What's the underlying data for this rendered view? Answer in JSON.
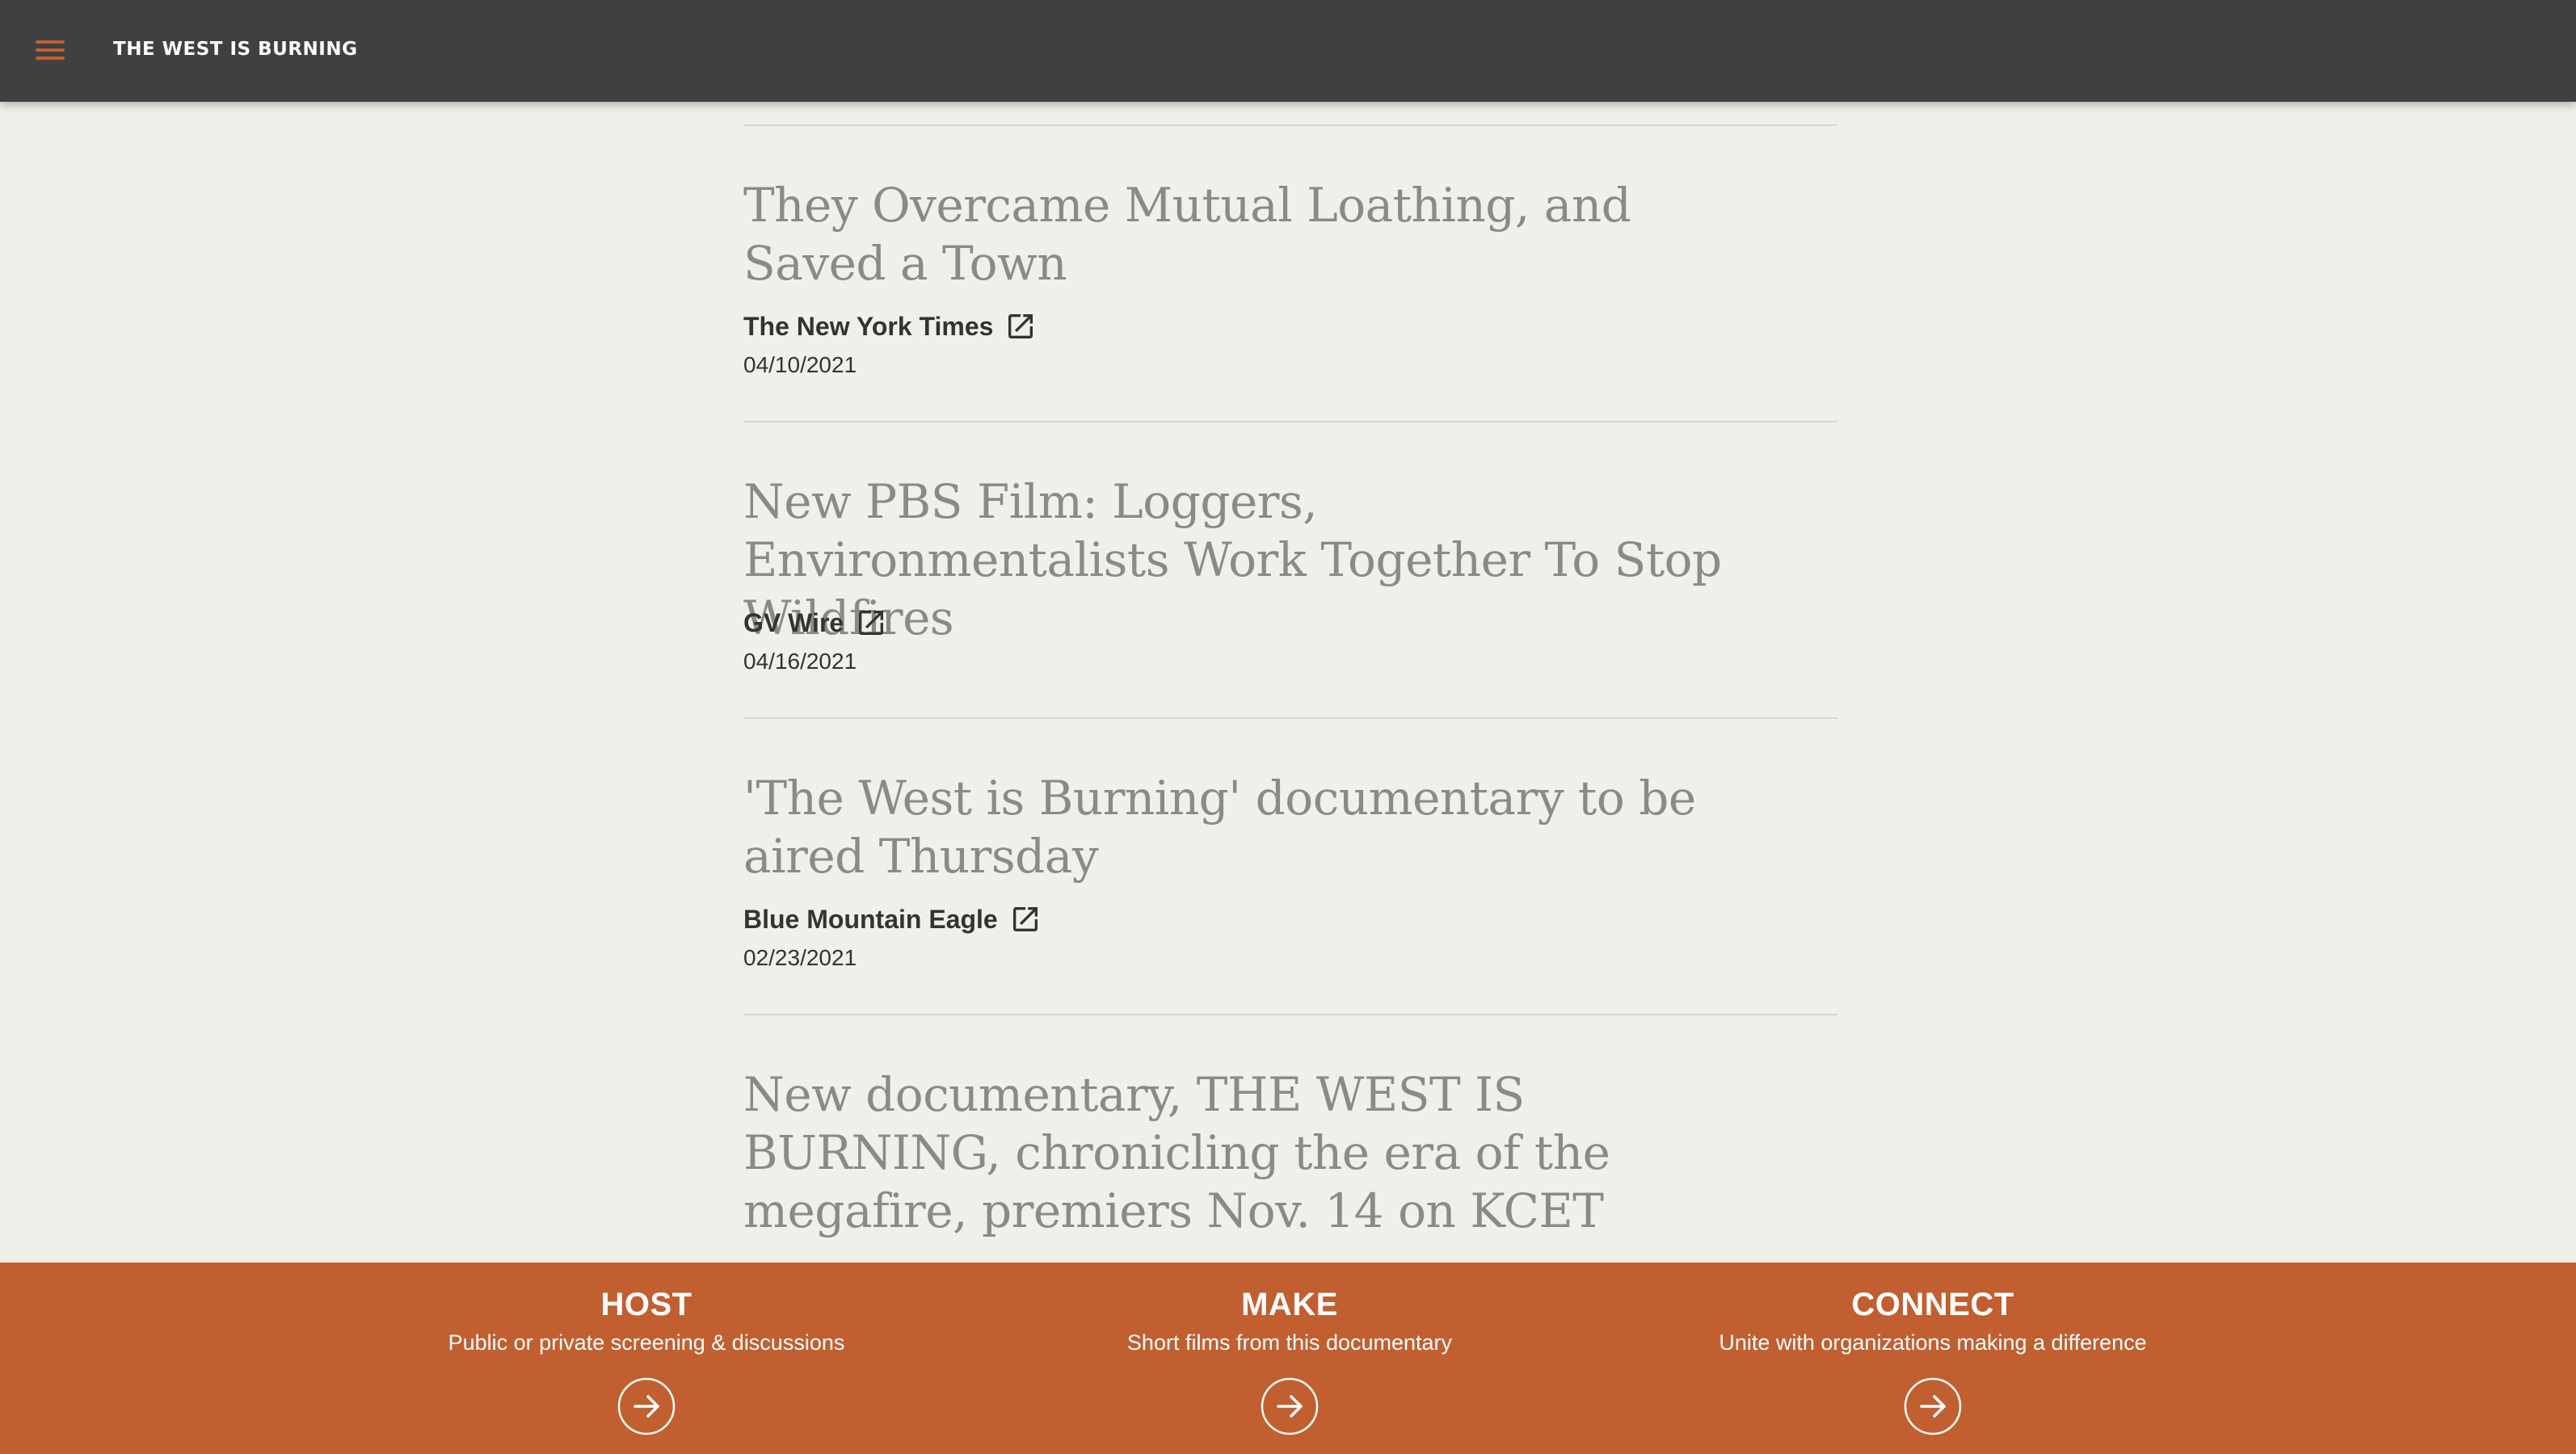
{
  "header": {
    "brand": "THE WEST IS BURNING",
    "menu_icon": "hamburger-menu-icon",
    "accent_color": "#c15f31",
    "background_color": "#3f4042"
  },
  "articles": [
    {
      "title": "They Overcame Mutual Loathing, and Saved a Town",
      "source": "The New York Times",
      "date": "04/10/2021",
      "icon": "external-link-icon"
    },
    {
      "title": "New PBS Film: Loggers, Environmentalists Work Together To Stop Wildfires",
      "source": "GV Wire",
      "date": "04/16/2021",
      "icon": "external-link-icon"
    },
    {
      "title": "'The West is Burning' documentary to be aired Thursday",
      "source": "Blue Mountain Eagle",
      "date": "02/23/2021",
      "icon": "external-link-icon"
    },
    {
      "title": "New documentary, THE WEST IS BURNING, chronicling the era of the megafire, premiers Nov. 14 on KCET",
      "source": "",
      "date": "",
      "icon": ""
    }
  ],
  "cta_bar": {
    "background_color": "#c15f31",
    "items": [
      {
        "title": "HOST",
        "subtitle": "Public or private screening & discussions",
        "icon": "arrow-right-circle-icon"
      },
      {
        "title": "MAKE",
        "subtitle": "Short films from this documentary",
        "icon": "arrow-right-circle-icon"
      },
      {
        "title": "CONNECT",
        "subtitle": "Unite with organizations making a difference",
        "icon": "arrow-right-circle-icon"
      }
    ]
  }
}
